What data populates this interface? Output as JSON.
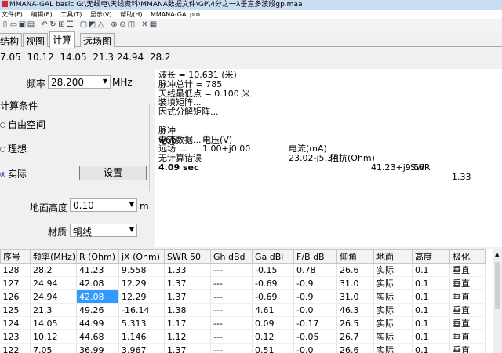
{
  "window": {
    "title": "MMANA-GAL basic  G:\\无线电\\天线资料\\MMANA数据文件\\GP\\4分之一λ垂直多波段gp.maa"
  },
  "menu": [
    "文件(F)",
    "编辑(E)",
    "工具(T)",
    "显示(V)",
    "帮助(H)",
    "MMANA-GALpro"
  ],
  "tabs": [
    "结构",
    "视图",
    "计算",
    "远场图"
  ],
  "freq_list": "7.05  10.12  14.05  21.3 24.94  28.2",
  "controls": {
    "freq_label": "频率",
    "freq_value": "28.200",
    "freq_unit": "MHz",
    "group_title": "计算条件",
    "radio_free": "自由空间",
    "radio_ideal": "理想",
    "radio_real": "实际",
    "settings_button": "设置",
    "height_label": "地面高度",
    "height_value": "0.10",
    "height_unit": "m",
    "material_label": "材质",
    "material_value": "铜线"
  },
  "results": {
    "lines": [
      "波长 = 10.631 (米)",
      "脉冲总计 = 785",
      "天线最低点 = 0.100 米",
      "装填矩阵...",
      "因式分解矩阵..."
    ],
    "header": {
      "pulse": "脉冲",
      "voltage": "电压(V)",
      "current": "电流(mA)",
      "impedance": "阻抗(Ohm)",
      "swr": "SWR"
    },
    "row": {
      "pulse": "w6b",
      "voltage": "1.00+j0.00",
      "current": "23.02-j5.34",
      "impedance": "41.23+j9.56",
      "swr": "1.33"
    },
    "lines2": [
      "电流数据...",
      "远场 ...",
      "无计算错误",
      "4.09 sec"
    ]
  },
  "table": {
    "columns": [
      "序号",
      "频率(MHz)",
      "R (Ohm)",
      "jX (Ohm)",
      "SWR 50",
      "Gh dBd",
      "Ga dBi",
      "F/B dB",
      "仰角",
      "地面",
      "高度",
      "极化"
    ],
    "rows": [
      [
        "128",
        "28.2",
        "41.23",
        "9.558",
        "1.33",
        "---",
        "-0.15",
        "0.78",
        "26.6",
        "实际",
        "0.1",
        "垂直"
      ],
      [
        "127",
        "24.94",
        "42.08",
        "12.29",
        "1.37",
        "---",
        "-0.69",
        "-0.9",
        "31.0",
        "实际",
        "0.1",
        "垂直"
      ],
      [
        "126",
        "24.94",
        "42.08",
        "12.29",
        "1.37",
        "---",
        "-0.69",
        "-0.9",
        "31.0",
        "实际",
        "0.1",
        "垂直"
      ],
      [
        "125",
        "21.3",
        "49.26",
        "-16.14",
        "1.38",
        "---",
        "4.61",
        "-0.0",
        "46.3",
        "实际",
        "0.1",
        "垂直"
      ],
      [
        "124",
        "14.05",
        "44.99",
        "5.313",
        "1.17",
        "---",
        "0.09",
        "-0.17",
        "26.5",
        "实际",
        "0.1",
        "垂直"
      ],
      [
        "123",
        "10.12",
        "44.68",
        "1.146",
        "1.12",
        "---",
        "0.12",
        "-0.05",
        "26.7",
        "实际",
        "0.1",
        "垂直"
      ],
      [
        "122",
        "7.05",
        "36.99",
        "3.967",
        "1.37",
        "---",
        "0.51",
        "-0.0",
        "26.6",
        "实际",
        "0.1",
        "垂直"
      ]
    ]
  },
  "colors": {
    "selection": "#3399ff",
    "titlebar": "#c9dcf2"
  }
}
